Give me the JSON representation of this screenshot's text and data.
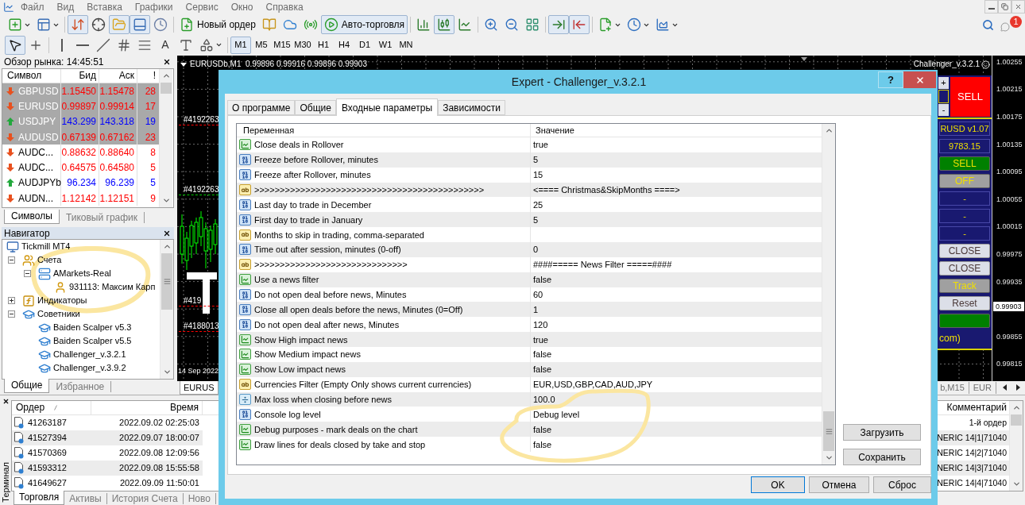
{
  "menu": [
    "Файл",
    "Вид",
    "Вставка",
    "Графики",
    "Сервис",
    "Окно",
    "Справка"
  ],
  "toolbar": [
    {
      "kind": "icon",
      "pressed": false
    },
    {
      "kind": "icon",
      "pressed": false
    },
    {
      "kind": "icon",
      "pressed": true
    },
    {
      "kind": "icon",
      "pressed": false
    },
    {
      "kind": "icon",
      "pressed": true
    },
    {
      "kind": "icon",
      "pressed": true
    },
    {
      "kind": "icon",
      "pressed": false
    },
    {
      "kind": "text",
      "label": "Новый ордер",
      "pressed": false
    },
    {
      "kind": "icon",
      "pressed": false
    },
    {
      "kind": "icon",
      "pressed": false
    },
    {
      "kind": "icon",
      "pressed": false
    },
    {
      "kind": "text",
      "label": "Авто-торговля",
      "pressed": true
    },
    {
      "kind": "icon",
      "pressed": false
    },
    {
      "kind": "icon",
      "pressed": true
    },
    {
      "kind": "icon",
      "pressed": false
    },
    {
      "kind": "icon",
      "pressed": false
    },
    {
      "kind": "icon",
      "pressed": false
    },
    {
      "kind": "icon",
      "pressed": false
    },
    {
      "kind": "icon",
      "pressed": true
    },
    {
      "kind": "icon",
      "pressed": true
    },
    {
      "kind": "icon",
      "pressed": false
    },
    {
      "kind": "icon",
      "pressed": false
    },
    {
      "kind": "icon",
      "pressed": false
    }
  ],
  "notifications": {
    "count": "1"
  },
  "drawing_tools": [
    {
      "kind": "icon",
      "pressed": true
    },
    {
      "kind": "icon",
      "pressed": false
    },
    {
      "kind": "icon",
      "pressed": false
    },
    {
      "kind": "icon",
      "pressed": false
    },
    {
      "kind": "icon",
      "pressed": false
    },
    {
      "kind": "icon",
      "pressed": false
    },
    {
      "kind": "icon",
      "pressed": false
    },
    {
      "kind": "glyph",
      "label": "A",
      "pressed": false
    },
    {
      "kind": "icon",
      "pressed": false
    },
    {
      "kind": "icon",
      "pressed": false
    }
  ],
  "timeframes": [
    {
      "label": "M1",
      "selected": true
    },
    {
      "label": "M5",
      "selected": false
    },
    {
      "label": "M15",
      "selected": false
    },
    {
      "label": "M30",
      "selected": false
    },
    {
      "label": "H1",
      "selected": false
    },
    {
      "label": "H4",
      "selected": false
    },
    {
      "label": "D1",
      "selected": false
    },
    {
      "label": "W1",
      "selected": false
    },
    {
      "label": "MN",
      "selected": false
    }
  ],
  "market_watch": {
    "title": "Обзор рынка: 14:45:51",
    "columns": [
      "Символ",
      "Бид",
      "Аск",
      "!"
    ],
    "rows": [
      {
        "symbol": "GBPUSD",
        "bid": "1.15450",
        "ask": "1.15478",
        "spread": "28",
        "rising": false,
        "selected": true
      },
      {
        "symbol": "EURUSD",
        "bid": "0.99897",
        "ask": "0.99914",
        "spread": "17",
        "rising": false,
        "selected": true
      },
      {
        "symbol": "USDJPY",
        "bid": "143.299",
        "ask": "143.318",
        "spread": "19",
        "rising": true,
        "selected": true
      },
      {
        "symbol": "AUDUSD",
        "bid": "0.67139",
        "ask": "0.67162",
        "spread": "23",
        "rising": false,
        "selected": true
      },
      {
        "symbol": "AUDC...",
        "bid": "0.88632",
        "ask": "0.88640",
        "spread": "8",
        "rising": false,
        "selected": false
      },
      {
        "symbol": "AUDC...",
        "bid": "0.64575",
        "ask": "0.64580",
        "spread": "5",
        "rising": false,
        "selected": false
      },
      {
        "symbol": "AUDJPYb",
        "bid": "96.234",
        "ask": "96.239",
        "spread": "5",
        "rising": true,
        "selected": false
      },
      {
        "symbol": "AUDN...",
        "bid": "1.12142",
        "ask": "1.12151",
        "spread": "9",
        "rising": false,
        "selected": false
      }
    ],
    "tabs": [
      {
        "label": "Символы",
        "selected": true
      },
      {
        "label": "Тиковый график",
        "selected": false
      }
    ]
  },
  "navigator": {
    "title": "Навигатор",
    "tree": [
      {
        "kind": "terminal",
        "label": "Tickmill MT4",
        "children": [
          {
            "kind": "accounts",
            "label": "Счета",
            "expanded": true,
            "children": [
              {
                "kind": "server",
                "label": "AMarkets-Real",
                "expanded": true,
                "children": [
                  {
                    "kind": "account",
                    "label": "931113: Максим Карп"
                  }
                ]
              }
            ]
          },
          {
            "kind": "indicators",
            "label": "Индикаторы",
            "expanded": false
          },
          {
            "kind": "experts",
            "label": "Советники",
            "expanded": true,
            "children": [
              {
                "kind": "expert",
                "label": "Baiden Scalper v5.3"
              },
              {
                "kind": "expert",
                "label": "Baiden Scalper v5.5"
              },
              {
                "kind": "expert",
                "label": "Challenger_v.3.2.1"
              },
              {
                "kind": "expert",
                "label": "Challenger_v.3.9.2"
              }
            ]
          }
        ]
      }
    ],
    "tabs": [
      {
        "label": "Общие",
        "selected": true
      },
      {
        "label": "Избранное",
        "selected": false
      }
    ]
  },
  "chart": {
    "title": "EURUSDb,M1  0.99896 0.99916 0.99896 0.99903",
    "expert_label": "Challenger_v.3.2.1",
    "order_labels": [
      {
        "label": "#4192263",
        "color": "#ff0000"
      },
      {
        "label": "#4192263",
        "color": "#00c800"
      },
      {
        "label": "#419",
        "color": "#ff0000"
      },
      {
        "label": "#4188013",
        "color": "#ff0000"
      }
    ],
    "date_label": "14 Sep 2022",
    "price_axis": [
      {
        "kind": "tick",
        "label": "1.00255"
      },
      {
        "kind": "tick",
        "label": "1.00215"
      },
      {
        "kind": "tick",
        "label": "1.00175"
      },
      {
        "kind": "tick",
        "label": "1.00135"
      },
      {
        "kind": "tick",
        "label": "1.00095"
      },
      {
        "kind": "tick",
        "label": "1.00055"
      },
      {
        "kind": "tick",
        "label": "1.00015"
      },
      {
        "kind": "tick",
        "label": "0.99975"
      },
      {
        "kind": "tick",
        "label": "0.99935"
      },
      {
        "kind": "current",
        "label": "0.99903"
      },
      {
        "kind": "tick",
        "label": "0.99855"
      },
      {
        "kind": "tick",
        "label": "0.99815"
      }
    ]
  },
  "expert_panel": {
    "stepper": [
      {
        "kind": "step",
        "label": "+"
      },
      {
        "kind": "field"
      },
      {
        "kind": "step",
        "label": "-"
      }
    ],
    "sell_button": {
      "label": "SELL",
      "color": "#ff0000"
    },
    "rows": [
      {
        "kind": "field",
        "label": "RUSD v1.07",
        "color": "#191970"
      },
      {
        "kind": "field",
        "label": "9783.15",
        "color": "#191970"
      },
      {
        "kind": "toggle",
        "label": "SELL",
        "color": "#008000"
      },
      {
        "kind": "toggle",
        "label": "OFF",
        "color": "#a0a0a0"
      },
      {
        "kind": "field",
        "label": "-",
        "color": "#191970"
      },
      {
        "kind": "field",
        "label": "-",
        "color": "#191970"
      },
      {
        "kind": "field",
        "label": "-",
        "color": "#191970"
      },
      {
        "kind": "button",
        "label": "CLOSE",
        "color": "#dcdfe8"
      },
      {
        "kind": "button",
        "label": "CLOSE",
        "color": "#dcdfe8"
      },
      {
        "kind": "toggle",
        "label": "Track",
        "color": "#a0a0a0"
      },
      {
        "kind": "button",
        "label": "Reset",
        "color": "#dcdfe8"
      },
      {
        "kind": "toggle",
        "color": "#008000"
      },
      {
        "kind": "text",
        "label": "com)"
      }
    ]
  },
  "chart_tabs": [
    {
      "label": "EURUS",
      "selected": true
    },
    {
      "label": "b,M15",
      "selected": false
    },
    {
      "label": "EUR",
      "selected": false
    }
  ],
  "terminal": {
    "title": "Терминал",
    "columns": [
      "Ордер",
      "Время",
      "Комментарий"
    ],
    "rows": [
      {
        "order": "41263187",
        "time": "2022.09.02 02:25:03",
        "comment": "1-й ордер"
      },
      {
        "order": "41527394",
        "time": "2022.09.07 18:00:07",
        "comment": "NERIC 14|1|71040"
      },
      {
        "order": "41570369",
        "time": "2022.09.08 12:09:56",
        "comment": "NERIC 14|2|71040"
      },
      {
        "order": "41593312",
        "time": "2022.09.08 15:55:58",
        "comment": "NERIC 14|3|71040"
      },
      {
        "order": "41649627",
        "time": "2022.09.09 11:50:01",
        "comment": "NERIC 14|4|71040"
      }
    ],
    "tabs": [
      {
        "label": "Торговля",
        "selected": true
      },
      {
        "label": "Активы",
        "selected": false
      },
      {
        "label": "История Счета",
        "selected": false
      },
      {
        "label": "Ново",
        "selected": false
      }
    ]
  },
  "dialog": {
    "title": "Expert - Challenger_v.3.2.1",
    "help": "?",
    "tabs": [
      {
        "label": "О программе",
        "selected": false
      },
      {
        "label": "Общие",
        "selected": false
      },
      {
        "label": "Входные параметры",
        "selected": true
      },
      {
        "label": "Зависимости",
        "selected": false
      }
    ],
    "columns": [
      "Переменная",
      "Значение"
    ],
    "rows": [
      {
        "kind": "bool",
        "name": "Close deals in Rollover",
        "value": "true"
      },
      {
        "kind": "int",
        "name": "Freeze before Rollover, minutes",
        "value": "5"
      },
      {
        "kind": "int",
        "name": "Freeze after Rollover, minutes",
        "value": "15"
      },
      {
        "kind": "string",
        "name": ">>>>>>>>>>>>>>>>>>>>>>>>>>>>>>>>>>>>>>>>>>>>>",
        "value": "<==== Christmas&SkipMonths ====>"
      },
      {
        "kind": "int",
        "name": "Last day to trade in December",
        "value": "25"
      },
      {
        "kind": "int",
        "name": "First day to trade in January",
        "value": "5"
      },
      {
        "kind": "string",
        "name": "Months to skip in trading, comma-separated"
      },
      {
        "kind": "int",
        "name": "Time out after session, minutes (0-off)",
        "value": "0"
      },
      {
        "kind": "string",
        "name": ">>>>>>>>>>>>>>>>>>>>>>>>>>>>>>",
        "value": "####===== News Filter =====####"
      },
      {
        "kind": "bool",
        "name": "Use a news filter",
        "value": "false"
      },
      {
        "kind": "int",
        "name": "Do not open deal before news, Minutes",
        "value": "60"
      },
      {
        "kind": "int",
        "name": "Close all open deals before the news, Minutes (0=Off)",
        "value": "1"
      },
      {
        "kind": "int",
        "name": "Do not open deal after news, Minutes",
        "value": "120"
      },
      {
        "kind": "bool",
        "name": "Show High impact news",
        "value": "true"
      },
      {
        "kind": "bool",
        "name": "Show Medium impact news",
        "value": "false"
      },
      {
        "kind": "bool",
        "name": "Show Low impact news",
        "value": "false"
      },
      {
        "kind": "string",
        "name": "Currencies Filter (Empty Only shows current currencies)",
        "value": "EUR,USD,GBP,CAD,AUD,JPY"
      },
      {
        "kind": "double",
        "name": "Max loss when closing before news",
        "value": "100.0"
      },
      {
        "kind": "int",
        "name": "Console log level",
        "value": "Debug level"
      },
      {
        "kind": "bool",
        "name": "Debug purposes - mark deals on the chart",
        "value": "false"
      },
      {
        "kind": "bool",
        "name": "Draw lines for deals closed by take and stop",
        "value": "false"
      }
    ],
    "side_buttons": [
      "Загрузить",
      "Сохранить"
    ],
    "buttons": [
      {
        "label": "OK",
        "default": true
      },
      {
        "label": "Отмена",
        "default": false
      },
      {
        "label": "Сброс",
        "default": false
      }
    ]
  }
}
